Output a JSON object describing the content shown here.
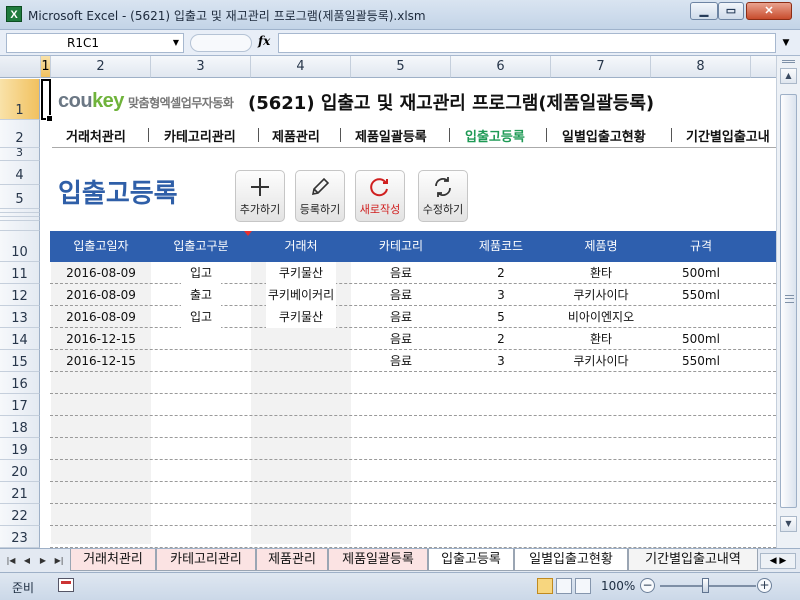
{
  "window": {
    "title": "Microsoft Excel - (5621) 입출고 및 재고관리 프로그램(제품일괄등록).xlsm"
  },
  "formula_bar": {
    "name_box": "R1C1",
    "fx": "fx",
    "value": ""
  },
  "columns": [
    "1",
    "2",
    "3",
    "4",
    "5",
    "6",
    "7",
    "8"
  ],
  "rows": [
    "1",
    "2",
    "3",
    "4",
    "5",
    "10",
    "11",
    "12",
    "13",
    "14",
    "15",
    "16",
    "17",
    "18",
    "19",
    "20",
    "21",
    "22",
    "23"
  ],
  "brand": {
    "logo_a": "cou",
    "logo_b": "key",
    "tagline": "맞춤형엑셀업무자동화"
  },
  "doc_title": "(5621) 입출고 및 재고관리 프로그램(제품일괄등록)",
  "menu": [
    "거래처관리",
    "카테고리관리",
    "제품관리",
    "제품일괄등록",
    "입출고등록",
    "일별입출고현황",
    "기간별입출고내"
  ],
  "active_menu": "입출고등록",
  "page_title": "입출고등록",
  "buttons": [
    {
      "label": "추가하기",
      "icon": "plus-icon"
    },
    {
      "label": "등록하기",
      "icon": "pencil-icon"
    },
    {
      "label": "새로작성",
      "icon": "refresh-icon"
    },
    {
      "label": "수정하기",
      "icon": "sync-icon"
    }
  ],
  "table": {
    "headers": [
      "입출고일자",
      "입출고구분",
      "거래처",
      "카테고리",
      "제품코드",
      "제품명",
      "규격"
    ],
    "rows": [
      [
        "2016-08-09",
        "입고",
        "쿠키물산",
        "음료",
        "2",
        "환타",
        "500ml"
      ],
      [
        "2016-08-09",
        "출고",
        "쿠키베이커리",
        "음료",
        "3",
        "쿠키사이다",
        "550ml"
      ],
      [
        "2016-08-09",
        "입고",
        "쿠키물산",
        "음료",
        "5",
        "비아이엔지오",
        ""
      ],
      [
        "2016-12-15",
        "",
        "",
        "음료",
        "2",
        "환타",
        "500ml"
      ],
      [
        "2016-12-15",
        "",
        "",
        "음료",
        "3",
        "쿠키사이다",
        "550ml"
      ],
      [
        "",
        "",
        "",
        "",
        "",
        "",
        ""
      ],
      [
        "",
        "",
        "",
        "",
        "",
        "",
        ""
      ],
      [
        "",
        "",
        "",
        "",
        "",
        "",
        ""
      ],
      [
        "",
        "",
        "",
        "",
        "",
        "",
        ""
      ],
      [
        "",
        "",
        "",
        "",
        "",
        "",
        ""
      ],
      [
        "",
        "",
        "",
        "",
        "",
        "",
        ""
      ],
      [
        "",
        "",
        "",
        "",
        "",
        "",
        ""
      ],
      [
        "",
        "",
        "",
        "",
        "",
        "",
        ""
      ]
    ]
  },
  "sheet_tabs": [
    "거래처관리",
    "카테고리관리",
    "제품관리",
    "제품일괄등록",
    "입출고등록",
    "일별입출고현황",
    "기간별입출고내역"
  ],
  "active_sheet": "입출고등록",
  "status": {
    "ready": "준비",
    "zoom": "100%",
    "zoom_level_percent": 100
  },
  "colors": {
    "accent_blue": "#2e5fae",
    "title_blue": "#2f5fa8",
    "active_menu_green": "#1e9a55",
    "brand_green": "#6fb33b"
  }
}
